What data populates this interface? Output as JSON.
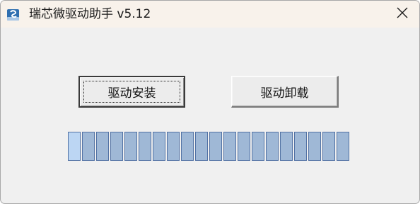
{
  "window": {
    "title": "瑞芯微驱动助手 v5.12",
    "app_icon": "rockchip-app-icon",
    "close_icon": "close-icon"
  },
  "buttons": {
    "install_label": "驱动安装",
    "uninstall_label": "驱动卸载"
  },
  "progress": {
    "segments_total": 20,
    "active_segments": 1,
    "segment_color": "#9fb8d6",
    "active_segment_color": "#bcd6f3",
    "border_color": "#5272a4"
  }
}
